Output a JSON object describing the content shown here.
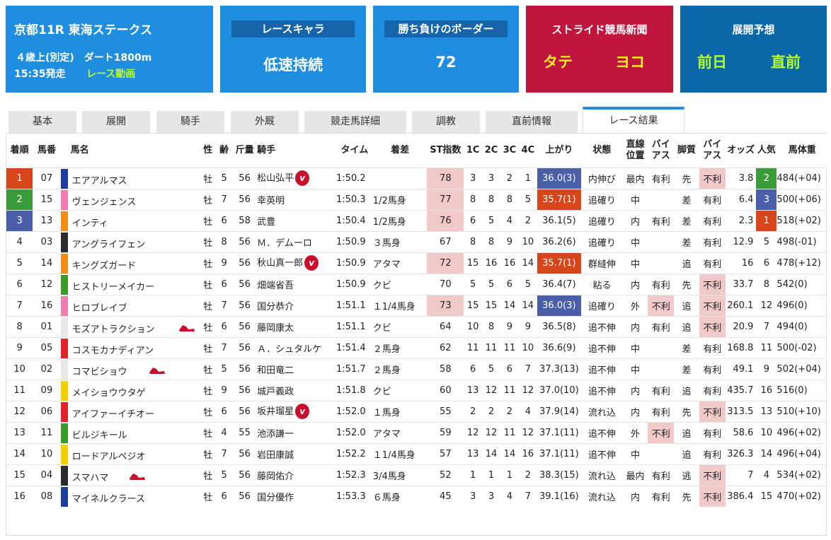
{
  "race": {
    "title": "京都11R 東海ステークス",
    "age": "４歳上(別定)",
    "course": "ダート1800m",
    "start": "15:35発走",
    "video": "レース動画"
  },
  "chara": {
    "label": "レースキャラ",
    "value": "低速持続"
  },
  "border": {
    "label": "勝ち負けのボーダー",
    "value": "72"
  },
  "stride": {
    "label": "ストライド競馬新聞",
    "tate": "タテ",
    "yoko": "ヨコ"
  },
  "forecast": {
    "label": "展開予想",
    "prev": "前日",
    "just": "直前"
  },
  "tabs": [
    {
      "label": "基本"
    },
    {
      "label": "展開"
    },
    {
      "label": "騎手"
    },
    {
      "label": "外厩"
    },
    {
      "label": "競走馬詳細"
    },
    {
      "label": "調教"
    },
    {
      "label": "直前情報"
    },
    {
      "label": "レース結果"
    }
  ],
  "columns": {
    "rank": "着順",
    "num": "馬番",
    "name": "馬名",
    "sex": "性",
    "age": "齢",
    "weight": "斤量",
    "jockey": "騎手",
    "time": "タイム",
    "margin": "着差",
    "st": "ST指数",
    "c1": "1C",
    "c2": "2C",
    "c3": "3C",
    "c4": "4C",
    "agari": "上がり",
    "cond": "状態",
    "pos1": "直線",
    "pos2": "位置",
    "bias1": "バイ",
    "bias2": "アス",
    "kyakushitsu": "脚質",
    "bias3": "バイ",
    "bias4": "アス",
    "odds": "オッズ",
    "pop": "人気",
    "bw": "馬体重"
  },
  "colors": {
    "frame1": "#e8e8e8",
    "frame2": "#2b2b2b",
    "frame3": "#e0242a",
    "frame4": "#1e3fa0",
    "frame5": "#f0d000",
    "frame6": "#3a9a2a",
    "frame7": "#f08c18",
    "frame8": "#ee7fb0",
    "v_badge": "#c8102e",
    "shoe": "#c8102e"
  },
  "rows": [
    {
      "rank": "1",
      "num": "07",
      "frame": "#1e3fa0",
      "name": "エアアルマス",
      "sex": "牡",
      "age": "5",
      "wt": "56",
      "jockey": "松山弘平",
      "v": true,
      "time": "1:50.2",
      "margin": "",
      "st": "78",
      "stPink": true,
      "c1": "3",
      "c2": "3",
      "c3": "2",
      "c4": "1",
      "agari": "36.0(3)",
      "agariHi": "blue",
      "cond": "内伸び",
      "pos": "最内",
      "bias": "有利",
      "kyaku": "先",
      "bias2": "不利",
      "bias2Pink": true,
      "odds": "3.8",
      "pop": "2",
      "popHi": "rk2",
      "bw": "484(+04)",
      "rankHi": "rk1"
    },
    {
      "rank": "2",
      "num": "15",
      "frame": "#ee7fb0",
      "name": "ヴェンジェンス",
      "sex": "牡",
      "age": "7",
      "wt": "56",
      "jockey": "幸英明",
      "v": false,
      "time": "1:50.3",
      "margin": "1/2馬身",
      "st": "77",
      "stPink": true,
      "c1": "8",
      "c2": "8",
      "c3": "8",
      "c4": "5",
      "agari": "35.7(1)",
      "agariHi": "red",
      "cond": "追確り",
      "pos": "中",
      "bias": "",
      "kyaku": "差",
      "bias2": "有利",
      "bias2Pink": false,
      "odds": "6.4",
      "pop": "3",
      "popHi": "rk3",
      "bw": "500(+06)",
      "rankHi": "rk2"
    },
    {
      "rank": "3",
      "num": "13",
      "frame": "#f08c18",
      "name": "インティ",
      "sex": "牡",
      "age": "6",
      "wt": "58",
      "jockey": "武豊",
      "v": false,
      "time": "1:50.4",
      "margin": "1/2馬身",
      "st": "76",
      "stPink": true,
      "c1": "6",
      "c2": "5",
      "c3": "4",
      "c4": "2",
      "agari": "36.1(5)",
      "agariHi": "",
      "cond": "追確り",
      "pos": "内",
      "bias": "有利",
      "kyaku": "差",
      "bias2": "有利",
      "bias2Pink": false,
      "odds": "2.3",
      "pop": "1",
      "popHi": "rk1",
      "bw": "518(+02)",
      "rankHi": "rk3"
    },
    {
      "rank": "4",
      "num": "03",
      "frame": "#2b2b2b",
      "name": "アングライフェン",
      "sex": "牡",
      "age": "8",
      "wt": "56",
      "jockey": "Ｍ．デムーロ",
      "v": false,
      "time": "1:50.9",
      "margin": "３馬身",
      "st": "67",
      "stPink": false,
      "c1": "8",
      "c2": "8",
      "c3": "9",
      "c4": "10",
      "agari": "36.2(6)",
      "agariHi": "",
      "cond": "追確り",
      "pos": "中",
      "bias": "",
      "kyaku": "差",
      "bias2": "有利",
      "bias2Pink": false,
      "odds": "12.9",
      "pop": "5",
      "popHi": "",
      "bw": "498(-01)",
      "rankHi": ""
    },
    {
      "rank": "5",
      "num": "14",
      "frame": "#f08c18",
      "name": "キングズガード",
      "sex": "牡",
      "age": "9",
      "wt": "56",
      "jockey": "秋山真一郎",
      "v": true,
      "time": "1:50.9",
      "margin": "アタマ",
      "st": "72",
      "stPink": true,
      "c1": "15",
      "c2": "16",
      "c3": "16",
      "c4": "14",
      "agari": "35.7(1)",
      "agariHi": "red",
      "cond": "群縫伸",
      "pos": "中",
      "bias": "",
      "kyaku": "追",
      "bias2": "有利",
      "bias2Pink": false,
      "odds": "16",
      "pop": "6",
      "popHi": "",
      "bw": "478(+12)",
      "rankHi": ""
    },
    {
      "rank": "6",
      "num": "12",
      "frame": "#3a9a2a",
      "name": "ヒストリーメイカー",
      "sex": "牡",
      "age": "6",
      "wt": "56",
      "jockey": "畑端省吾",
      "v": false,
      "time": "1:50.9",
      "margin": "クビ",
      "st": "70",
      "stPink": false,
      "c1": "5",
      "c2": "5",
      "c3": "6",
      "c4": "5",
      "agari": "36.4(7)",
      "agariHi": "",
      "cond": "粘る",
      "pos": "内",
      "bias": "有利",
      "kyaku": "先",
      "bias2": "不利",
      "bias2Pink": true,
      "odds": "33.7",
      "pop": "8",
      "popHi": "",
      "bw": "542(0)",
      "rankHi": ""
    },
    {
      "rank": "7",
      "num": "16",
      "frame": "#ee7fb0",
      "name": "ヒロブレイブ",
      "sex": "牡",
      "age": "7",
      "wt": "56",
      "jockey": "国分恭介",
      "v": false,
      "time": "1:51.1",
      "margin": "１1/4馬身",
      "st": "73",
      "stPink": true,
      "c1": "15",
      "c2": "15",
      "c3": "14",
      "c4": "14",
      "agari": "36.0(3)",
      "agariHi": "blue",
      "cond": "追確り",
      "pos": "外",
      "bias": "不利",
      "biasPink": true,
      "kyaku": "追",
      "bias2": "不利",
      "bias2Pink": true,
      "odds": "260.1",
      "pop": "12",
      "popHi": "",
      "bw": "496(0)",
      "rankHi": ""
    },
    {
      "rank": "8",
      "num": "01",
      "frame": "#e8e8e8",
      "name": "モズアトラクション",
      "shoe": true,
      "sex": "牡",
      "age": "6",
      "wt": "56",
      "jockey": "藤岡康太",
      "v": false,
      "time": "1:51.1",
      "margin": "クビ",
      "st": "64",
      "stPink": false,
      "c1": "10",
      "c2": "8",
      "c3": "9",
      "c4": "9",
      "agari": "36.5(8)",
      "agariHi": "",
      "cond": "追不伸",
      "pos": "内",
      "bias": "有利",
      "kyaku": "追",
      "bias2": "不利",
      "bias2Pink": true,
      "odds": "20.9",
      "pop": "7",
      "popHi": "",
      "bw": "494(0)",
      "rankHi": ""
    },
    {
      "rank": "9",
      "num": "05",
      "frame": "#e0242a",
      "name": "コスモカナディアン",
      "sex": "牡",
      "age": "7",
      "wt": "56",
      "jockey": "Ａ．シュタルケ",
      "v": false,
      "time": "1:51.4",
      "margin": "２馬身",
      "st": "62",
      "stPink": false,
      "c1": "11",
      "c2": "11",
      "c3": "11",
      "c4": "10",
      "agari": "36.6(9)",
      "agariHi": "",
      "cond": "追不伸",
      "pos": "中",
      "bias": "",
      "kyaku": "差",
      "bias2": "有利",
      "bias2Pink": false,
      "odds": "168.8",
      "pop": "11",
      "popHi": "",
      "bw": "500(-02)",
      "rankHi": ""
    },
    {
      "rank": "10",
      "num": "02",
      "frame": "#e8e8e8",
      "name": "コマビショウ",
      "shoe": true,
      "sex": "牡",
      "age": "5",
      "wt": "56",
      "jockey": "和田竜二",
      "v": false,
      "time": "1:51.7",
      "margin": "２馬身",
      "st": "58",
      "stPink": false,
      "c1": "6",
      "c2": "5",
      "c3": "6",
      "c4": "7",
      "agari": "37.3(13)",
      "agariHi": "",
      "cond": "追不伸",
      "pos": "中",
      "bias": "",
      "kyaku": "差",
      "bias2": "有利",
      "bias2Pink": false,
      "odds": "49.1",
      "pop": "9",
      "popHi": "",
      "bw": "502(+04)",
      "rankHi": ""
    },
    {
      "rank": "11",
      "num": "09",
      "frame": "#f0d000",
      "name": "メイショウウタゲ",
      "sex": "牡",
      "age": "9",
      "wt": "56",
      "jockey": "城戸義政",
      "v": false,
      "time": "1:51.8",
      "margin": "クビ",
      "st": "60",
      "stPink": false,
      "c1": "13",
      "c2": "12",
      "c3": "11",
      "c4": "12",
      "agari": "37.0(10)",
      "agariHi": "",
      "cond": "追不伸",
      "pos": "内",
      "bias": "有利",
      "kyaku": "追",
      "bias2": "有利",
      "bias2Pink": false,
      "odds": "435.7",
      "pop": "16",
      "popHi": "",
      "bw": "516(0)",
      "rankHi": ""
    },
    {
      "rank": "12",
      "num": "06",
      "frame": "#e0242a",
      "name": "アイファーイチオー",
      "sex": "牡",
      "age": "6",
      "wt": "56",
      "jockey": "坂井瑠星",
      "v": true,
      "time": "1:52.0",
      "margin": "１馬身",
      "st": "55",
      "stPink": false,
      "c1": "2",
      "c2": "2",
      "c3": "2",
      "c4": "4",
      "agari": "37.9(14)",
      "agariHi": "",
      "cond": "流れ込",
      "pos": "内",
      "bias": "有利",
      "kyaku": "先",
      "bias2": "不利",
      "bias2Pink": true,
      "odds": "313.5",
      "pop": "13",
      "popHi": "",
      "bw": "510(+10)",
      "rankHi": ""
    },
    {
      "rank": "13",
      "num": "11",
      "frame": "#3a9a2a",
      "name": "ビルジキール",
      "sex": "牡",
      "age": "4",
      "wt": "55",
      "jockey": "池添謙一",
      "v": false,
      "time": "1:52.0",
      "margin": "アタマ",
      "st": "59",
      "stPink": false,
      "c1": "12",
      "c2": "12",
      "c3": "11",
      "c4": "12",
      "agari": "37.1(11)",
      "agariHi": "",
      "cond": "追不伸",
      "pos": "外",
      "bias": "不利",
      "biasPink": true,
      "kyaku": "追",
      "bias2": "有利",
      "bias2Pink": false,
      "odds": "58.6",
      "pop": "10",
      "popHi": "",
      "bw": "496(+02)",
      "rankHi": ""
    },
    {
      "rank": "14",
      "num": "10",
      "frame": "#f0d000",
      "name": "ロードアルペジオ",
      "sex": "牡",
      "age": "7",
      "wt": "56",
      "jockey": "岩田康誠",
      "v": false,
      "time": "1:52.2",
      "margin": "１1/4馬身",
      "st": "57",
      "stPink": false,
      "c1": "13",
      "c2": "14",
      "c3": "14",
      "c4": "16",
      "agari": "37.1(11)",
      "agariHi": "",
      "cond": "追不伸",
      "pos": "中",
      "bias": "",
      "kyaku": "追",
      "bias2": "有利",
      "bias2Pink": false,
      "odds": "326.3",
      "pop": "14",
      "popHi": "",
      "bw": "496(+04)",
      "rankHi": ""
    },
    {
      "rank": "15",
      "num": "04",
      "frame": "#2b2b2b",
      "name": "スマハマ",
      "shoe": true,
      "sex": "牡",
      "age": "5",
      "wt": "56",
      "jockey": "藤岡佑介",
      "v": false,
      "time": "1:52.3",
      "margin": "3/4馬身",
      "st": "52",
      "stPink": false,
      "c1": "1",
      "c2": "1",
      "c3": "1",
      "c4": "2",
      "agari": "38.3(15)",
      "agariHi": "",
      "cond": "流れ込",
      "pos": "最内",
      "bias": "有利",
      "kyaku": "逃",
      "bias2": "不利",
      "bias2Pink": true,
      "odds": "7",
      "pop": "4",
      "popHi": "",
      "bw": "534(+02)",
      "rankHi": ""
    },
    {
      "rank": "16",
      "num": "08",
      "frame": "#1e3fa0",
      "name": "マイネルクラース",
      "sex": "牡",
      "age": "6",
      "wt": "56",
      "jockey": "国分優作",
      "v": false,
      "time": "1:53.3",
      "margin": "６馬身",
      "st": "45",
      "stPink": false,
      "c1": "3",
      "c2": "3",
      "c3": "4",
      "c4": "7",
      "agari": "39.1(16)",
      "agariHi": "",
      "cond": "流れ込",
      "pos": "内",
      "bias": "有利",
      "kyaku": "先",
      "bias2": "不利",
      "bias2Pink": true,
      "odds": "386.4",
      "pop": "15",
      "popHi": "",
      "bw": "470(+02)",
      "rankHi": ""
    }
  ]
}
